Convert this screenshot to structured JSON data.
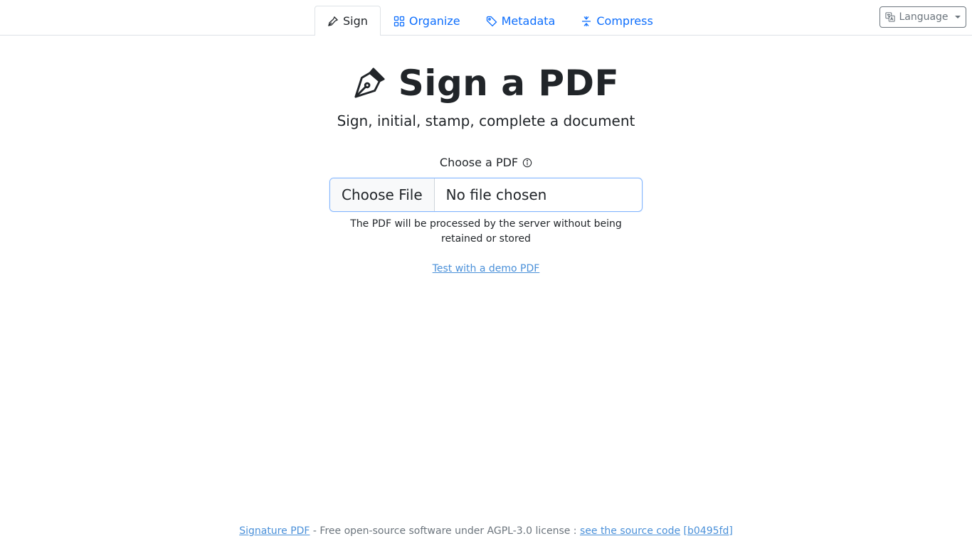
{
  "nav": {
    "tabs": [
      {
        "label": "Sign",
        "icon": "pen-icon",
        "active": true
      },
      {
        "label": "Organize",
        "icon": "grid-icon",
        "active": false
      },
      {
        "label": "Metadata",
        "icon": "tag-icon",
        "active": false
      },
      {
        "label": "Compress",
        "icon": "compress-icon",
        "active": false
      }
    ],
    "language_label": "Language"
  },
  "hero": {
    "title": "Sign a PDF",
    "subtitle": "Sign, initial, stamp, complete a document"
  },
  "upload": {
    "label": "Choose a PDF",
    "button_label": "Choose File",
    "status": "No file chosen",
    "notice": "The PDF will be processed by the server without being retained or stored",
    "demo_link": "Test with a demo PDF"
  },
  "footer": {
    "app_link": "Signature PDF",
    "license_text": " - Free open-source software under AGPL-3.0 license : ",
    "source_link": "see the source code",
    "version_link": "[b0495fd]"
  },
  "colors": {
    "link": "#0d6efd",
    "border": "#dee2e6",
    "text": "#212529"
  }
}
